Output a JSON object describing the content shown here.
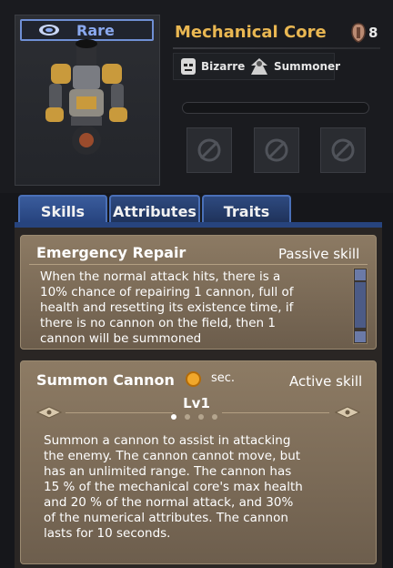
{
  "unit": {
    "rarity": "Rare",
    "name": "Mechanical Core",
    "cost": "8",
    "tags": [
      {
        "icon": "mask-icon",
        "label": "Bizarre"
      },
      {
        "icon": "summoner-icon",
        "label": "Summoner"
      }
    ],
    "equipment_slots": [
      "empty-slot-icon",
      "empty-slot-icon",
      "empty-slot-icon"
    ]
  },
  "tabs": [
    {
      "label": "Skills",
      "active": true
    },
    {
      "label": "Attributes",
      "active": false
    },
    {
      "label": "Traits",
      "active": false
    }
  ],
  "skills": [
    {
      "title": "Emergency Repair",
      "kind": "Passive skill",
      "description_lines": [
        "When the normal attack hits, there is a",
        "10% chance of repairing 1 cannon, full of",
        "health and resetting its existence time, if",
        "there is no cannon on the field, then 1",
        "cannon will be summoned"
      ]
    },
    {
      "title": "Summon Cannon",
      "cooldown_unit": "sec.",
      "kind": "Active skill",
      "level": "Lv1",
      "level_page": 1,
      "level_pages": 4,
      "description_lines": [
        "Summon a cannon to assist in attacking",
        "the enemy. The cannon cannot move, but",
        "has an unlimited range. The cannon has",
        "15 % of the mechanical core's max health",
        "and 20 % of the normal attack, and 30%",
        "of the numerical attributes. The cannon",
        "lasts for 10 seconds."
      ]
    }
  ],
  "colors": {
    "rarity": "#8aa9ef",
    "name": "#e9b752",
    "tab": "#2e4a80",
    "card": "#8c7a63"
  }
}
